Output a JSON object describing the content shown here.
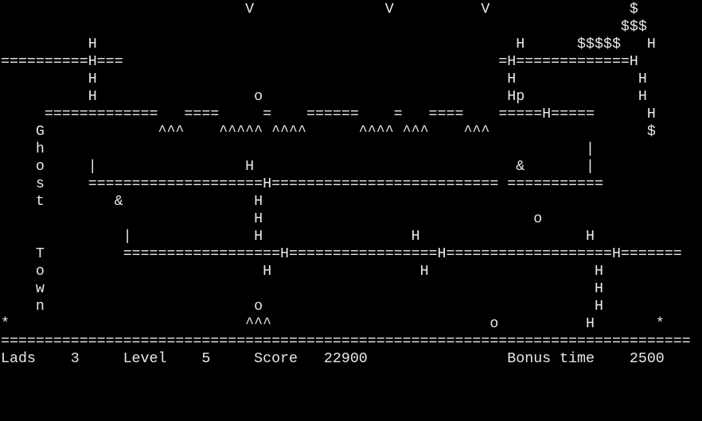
{
  "game": {
    "title": "Ghost Town",
    "rows": [
      "                            V               V          V                $",
      "                                                                       $$$",
      "          H                                                H      $$$$$   H",
      "==========H===                                           =H=============H",
      "          H                                               H              H",
      "          H                  o                            Hp             H",
      "     =============   ====     =    ======    =   ====    =====H=====      H",
      "    G             ^^^    ^^^^^ ^^^^      ^^^^ ^^^    ^^^                  $",
      "    h                                                              |",
      "    o     |                 H                              &       |",
      "    s     ====================H========================== ===========",
      "    t        &               H",
      "                             H                               o",
      "              |              H                 H                   H",
      "    T         ==================H=================H===================H=======",
      "    o                         H                 H                   H",
      "    w                                                               H",
      "    n                        o                                      H",
      "*                           ^^^                         o          H       *",
      "===============================================================================",
      "Lads    3     Level    5     Score   22900                Bonus time    2500"
    ]
  },
  "status": {
    "lads_label": "Lads",
    "lads_value": "3",
    "level_label": "Level",
    "level_value": "5",
    "score_label": "Score",
    "score_value": "22900",
    "bonus_label": "Bonus time",
    "bonus_value": "2500"
  },
  "colors": {
    "background": "#000000",
    "foreground": "#e8e8e8"
  }
}
